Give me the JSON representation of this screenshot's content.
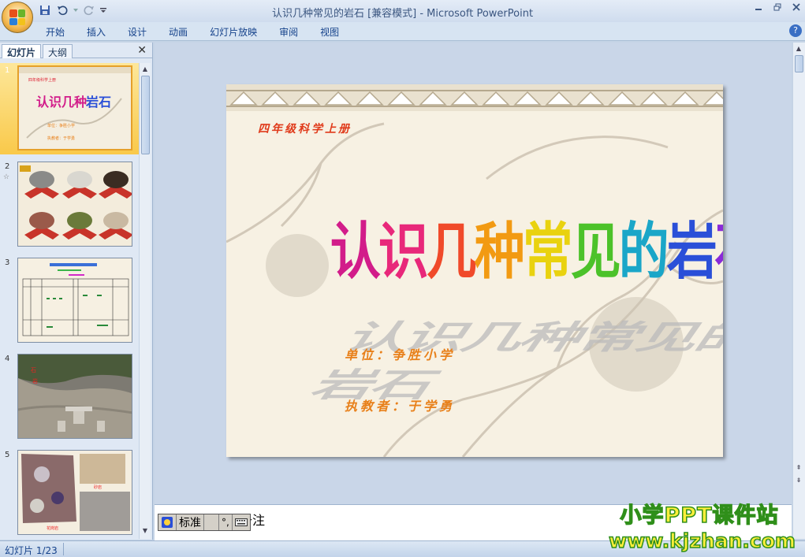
{
  "window": {
    "title": "认识几种常见的岩石 [兼容模式] - Microsoft PowerPoint"
  },
  "quick_access": [
    "save-icon",
    "undo-icon",
    "redo-icon",
    "customize-icon"
  ],
  "ribbon": {
    "tabs": [
      "开始",
      "插入",
      "设计",
      "动画",
      "幻灯片放映",
      "审阅",
      "视图"
    ]
  },
  "pane": {
    "tab_slides": "幻灯片",
    "tab_outline": "大纲",
    "thumbnails": [
      {
        "number": "1",
        "caption": "认识几种常见的岩石"
      },
      {
        "number": "2",
        "caption": ""
      },
      {
        "number": "3",
        "caption": ""
      },
      {
        "number": "4",
        "caption": ""
      },
      {
        "number": "5",
        "caption": ""
      }
    ]
  },
  "slide": {
    "subtitle": "四年级科学上册",
    "title_chars": [
      "认",
      "识",
      "几",
      "种",
      "常",
      "见",
      "的",
      "岩",
      "石"
    ],
    "title_colors": [
      "#d21c8a",
      "#e8287a",
      "#f04a2a",
      "#f29a12",
      "#e9d20f",
      "#4cc22a",
      "#1aa6c8",
      "#2a4fd8",
      "#8a2ad8"
    ],
    "unit": "单位：争胜小学",
    "teacher": "执教者：于学勇"
  },
  "notes": {
    "text": "单击此处添加备注"
  },
  "ime": {
    "mode": "标准"
  },
  "watermark": {
    "line1": "小学PPT课件站",
    "line2": "www.kjzhan.com"
  },
  "status": {
    "slide_indicator": "幻灯片 1/23"
  }
}
